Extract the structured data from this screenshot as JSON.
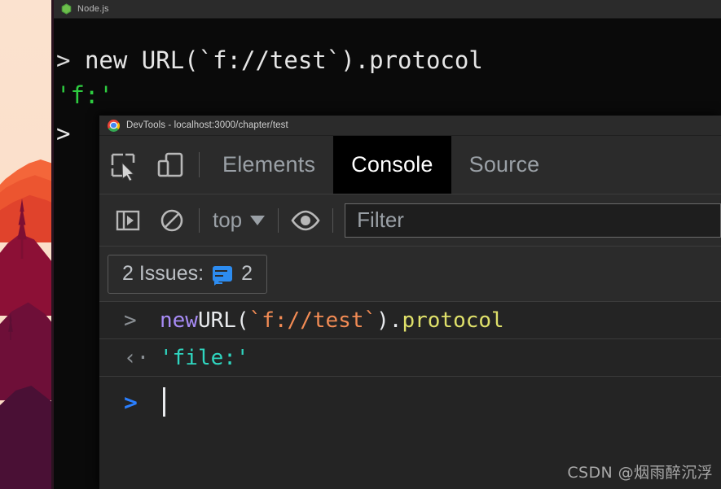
{
  "desktop": {
    "wallpaper_name": "sunset-mountains-wallpaper",
    "colors": {
      "sky": "#fbe2cf",
      "ridge_light": "#f4663a",
      "ridge_mid": "#ec5530",
      "ridge_dark": "#e0432c",
      "hill_crimson": "#8c1036",
      "hill_maroon": "#6e0f38",
      "hill_plum": "#4a1035"
    }
  },
  "node_window": {
    "title": "Node.js",
    "logo_icon": "nodejs-hexagon-icon",
    "lines": [
      {
        "prompt": ">",
        "text": "new URL(`f://test`).protocol",
        "kind": "input"
      },
      {
        "prompt": "",
        "text": "'f:'",
        "kind": "output"
      },
      {
        "prompt": ">",
        "text": "",
        "kind": "prompt"
      }
    ],
    "line1_prompt": ">",
    "line1_text": "new URL(`f://test`).protocol",
    "line2_text": "'f:'",
    "line3_prompt": ">"
  },
  "devtools": {
    "title": "DevTools - localhost:3000/chapter/test",
    "chrome_icon": "chrome-logo-icon",
    "toolbar_icons": [
      {
        "name": "inspect-element-icon",
        "label": "Inspect element"
      },
      {
        "name": "device-toolbar-icon",
        "label": "Toggle device toolbar"
      }
    ],
    "tabs": [
      {
        "label": "Elements",
        "active": false
      },
      {
        "label": "Console",
        "active": true
      },
      {
        "label": "Sources",
        "active": false
      }
    ],
    "tab_elements": "Elements",
    "tab_console": "Console",
    "tab_sources": "Source",
    "filter_toolbar": {
      "sidebar_icon": "console-sidebar-icon",
      "clear_icon": "clear-console-icon",
      "context_label": "top",
      "context_caret": "chevron-down-icon",
      "eye_icon": "live-expression-eye-icon",
      "filter_placeholder": "Filter",
      "filter_value": ""
    },
    "issues": {
      "label": "2 Issues:",
      "icon": "issue-bubble-icon",
      "count": "2"
    },
    "console": {
      "rows": [
        {
          "gutter": ">",
          "tokens": [
            {
              "text": "new ",
              "type": "keyword"
            },
            {
              "text": "URL(",
              "type": "plain"
            },
            {
              "text": "`f://test`",
              "type": "string"
            },
            {
              "text": ").",
              "type": "plain"
            },
            {
              "text": "protocol",
              "type": "property"
            }
          ]
        },
        {
          "gutter": "‹·",
          "tokens": [
            {
              "text": "'file:'",
              "type": "output"
            }
          ]
        }
      ],
      "input_gutter": ">",
      "input_value": "",
      "r1_gutter": ">",
      "r1_kw": "new ",
      "r1_fn": "URL(",
      "r1_str": "`f://test`",
      "r1_close": ").",
      "r1_prop": "protocol",
      "r2_gutter": "‹·",
      "r2_out": "'file:'",
      "r3_gutter": ">"
    }
  },
  "watermark": {
    "text": "CSDN @烟雨醉沉浮"
  }
}
